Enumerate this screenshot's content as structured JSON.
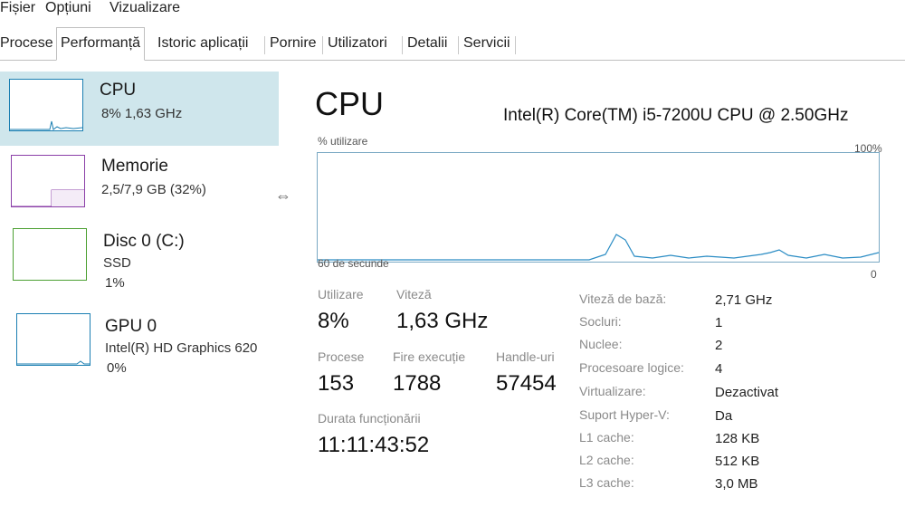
{
  "menu": {
    "items": [
      "Fișier",
      "Opțiuni",
      "Vizualizare"
    ]
  },
  "tabs": [
    {
      "label": "Procese"
    },
    {
      "label": "Performanță"
    },
    {
      "label": "Istoric aplicații"
    },
    {
      "label": "Pornire"
    },
    {
      "label": "Utilizatori"
    },
    {
      "label": "Detalii"
    },
    {
      "label": "Servicii"
    }
  ],
  "sidebar": {
    "items": [
      {
        "title": "CPU",
        "line1": "8% 1,63 GHz",
        "line2": "",
        "color": "#1b7fb2"
      },
      {
        "title": "Memorie",
        "line1": "2,5/7,9 GB (32%)",
        "line2": "",
        "color": "#8b3fa8"
      },
      {
        "title": "Disc 0 (C:)",
        "line1": "SSD",
        "line2": "1%",
        "color": "#4da033"
      },
      {
        "title": "GPU 0",
        "line1": "Intel(R) HD Graphics 620",
        "line2": "0%",
        "color": "#1b7fb2"
      }
    ]
  },
  "main": {
    "title": "CPU",
    "cpu_model": "Intel(R) Core(TM) i5-7200U CPU @ 2.50GHz",
    "graph": {
      "ylabel": "% utilizare",
      "ymax_label": "100%",
      "xlabel": "60 de secunde",
      "ymin_label": "0",
      "line_color": "#2a8cc4"
    },
    "stats": {
      "utilization": {
        "label": "Utilizare",
        "value": "8%"
      },
      "speed": {
        "label": "Viteză",
        "value": "1,63 GHz"
      },
      "processes": {
        "label": "Procese",
        "value": "153"
      },
      "threads": {
        "label": "Fire execuție",
        "value": "1788"
      },
      "handles": {
        "label": "Handle-uri",
        "value": "57454"
      },
      "uptime": {
        "label": "Durata funcționării",
        "value": "11:11:43:52"
      }
    },
    "specs": [
      {
        "label": "Viteză de bază:",
        "value": "2,71 GHz"
      },
      {
        "label": "Socluri:",
        "value": "1"
      },
      {
        "label": "Nuclee:",
        "value": "2"
      },
      {
        "label": "Procesoare logice:",
        "value": "4"
      },
      {
        "label": "Virtualizare:",
        "value": "Dezactivat"
      },
      {
        "label": "Suport Hyper-V:",
        "value": "Da"
      },
      {
        "label": "L1 cache:",
        "value": "128 KB"
      },
      {
        "label": "L2 cache:",
        "value": "512 KB"
      },
      {
        "label": "L3 cache:",
        "value": "3,0 MB"
      }
    ]
  }
}
